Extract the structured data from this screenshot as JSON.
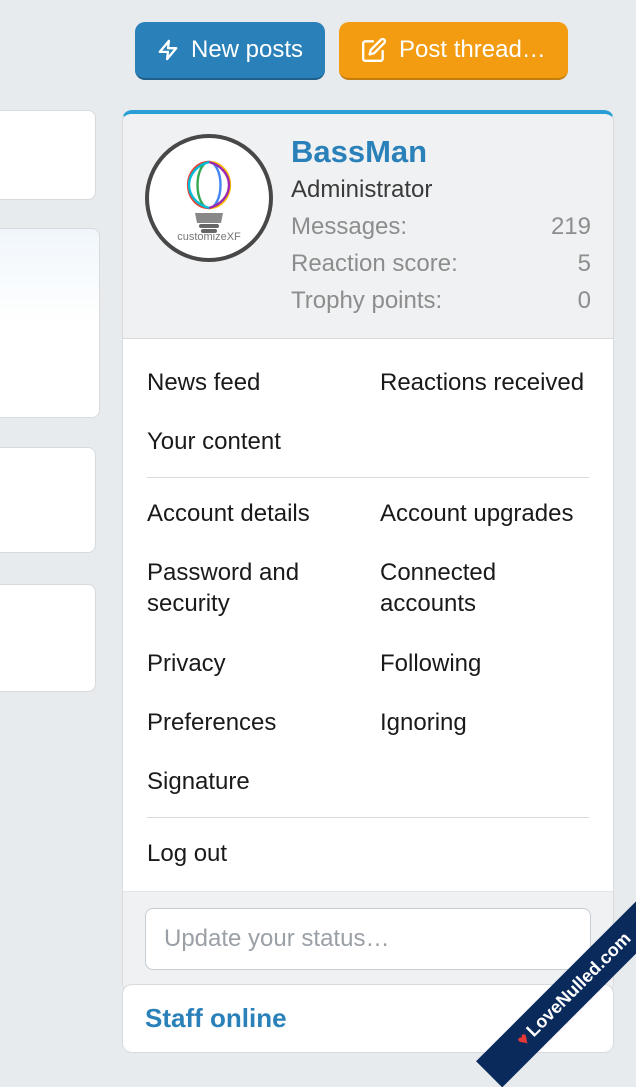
{
  "header": {
    "new_posts": "New posts",
    "post_thread": "Post thread…"
  },
  "user": {
    "name": "BassMan",
    "role": "Administrator",
    "avatar_label": "customizeXF",
    "stats": {
      "messages_label": "Messages:",
      "messages_value": "219",
      "reaction_label": "Reaction score:",
      "reaction_value": "5",
      "trophy_label": "Trophy points:",
      "trophy_value": "0"
    }
  },
  "menu": {
    "left": {
      "news_feed": "News feed",
      "your_content": "Your content",
      "account_details": "Account details",
      "password_security": "Password and security",
      "privacy": "Privacy",
      "preferences": "Preferences",
      "signature": "Signature",
      "log_out": "Log out"
    },
    "right": {
      "reactions_received": "Reactions received",
      "account_upgrades": "Account upgrades",
      "connected_accounts": "Connected accounts",
      "following": "Following",
      "ignoring": "Ignoring"
    }
  },
  "status": {
    "placeholder": "Update your status…"
  },
  "sidebar": {
    "staff_online": "Staff online"
  },
  "ribbon": {
    "text": "LoveNulled.com"
  }
}
